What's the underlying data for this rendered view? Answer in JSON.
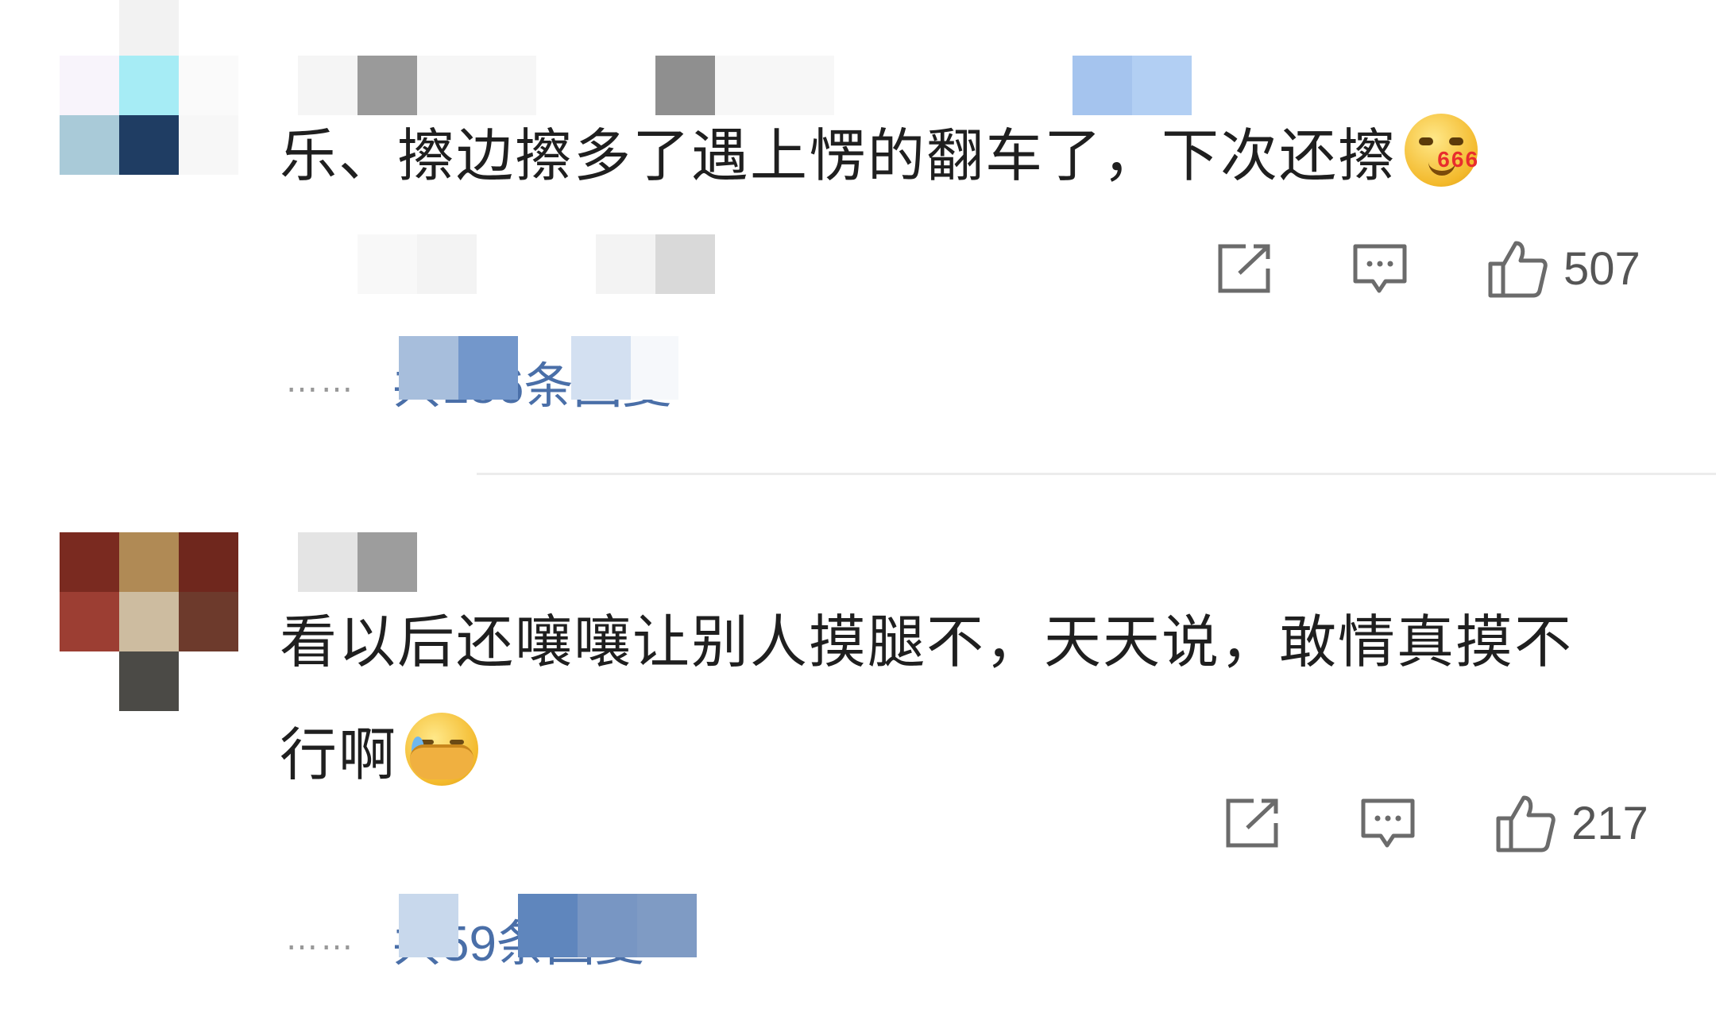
{
  "comments": [
    {
      "text": "乐、擦边擦多了遇上愣的翻车了，下次还擦",
      "emoji": "smirk-666-emoji",
      "emoji_badge": "666",
      "likes": "507",
      "replies": "共186条回复"
    },
    {
      "text_line1": "看以后还嚷嚷让别人摸腿不，天天说，敢情真摸不",
      "text_line2": "行啊",
      "emoji": "facepalm-cry-emoji",
      "likes": "217",
      "replies": "共59条回复"
    }
  ],
  "more_dots": "……",
  "icons": {
    "share": "share-icon",
    "comment": "comment-icon",
    "like": "thumbs-up-icon"
  },
  "colors": {
    "text": "#1f1f1f",
    "reply_link": "#4a6fa8",
    "icon": "#6b6b6b"
  }
}
